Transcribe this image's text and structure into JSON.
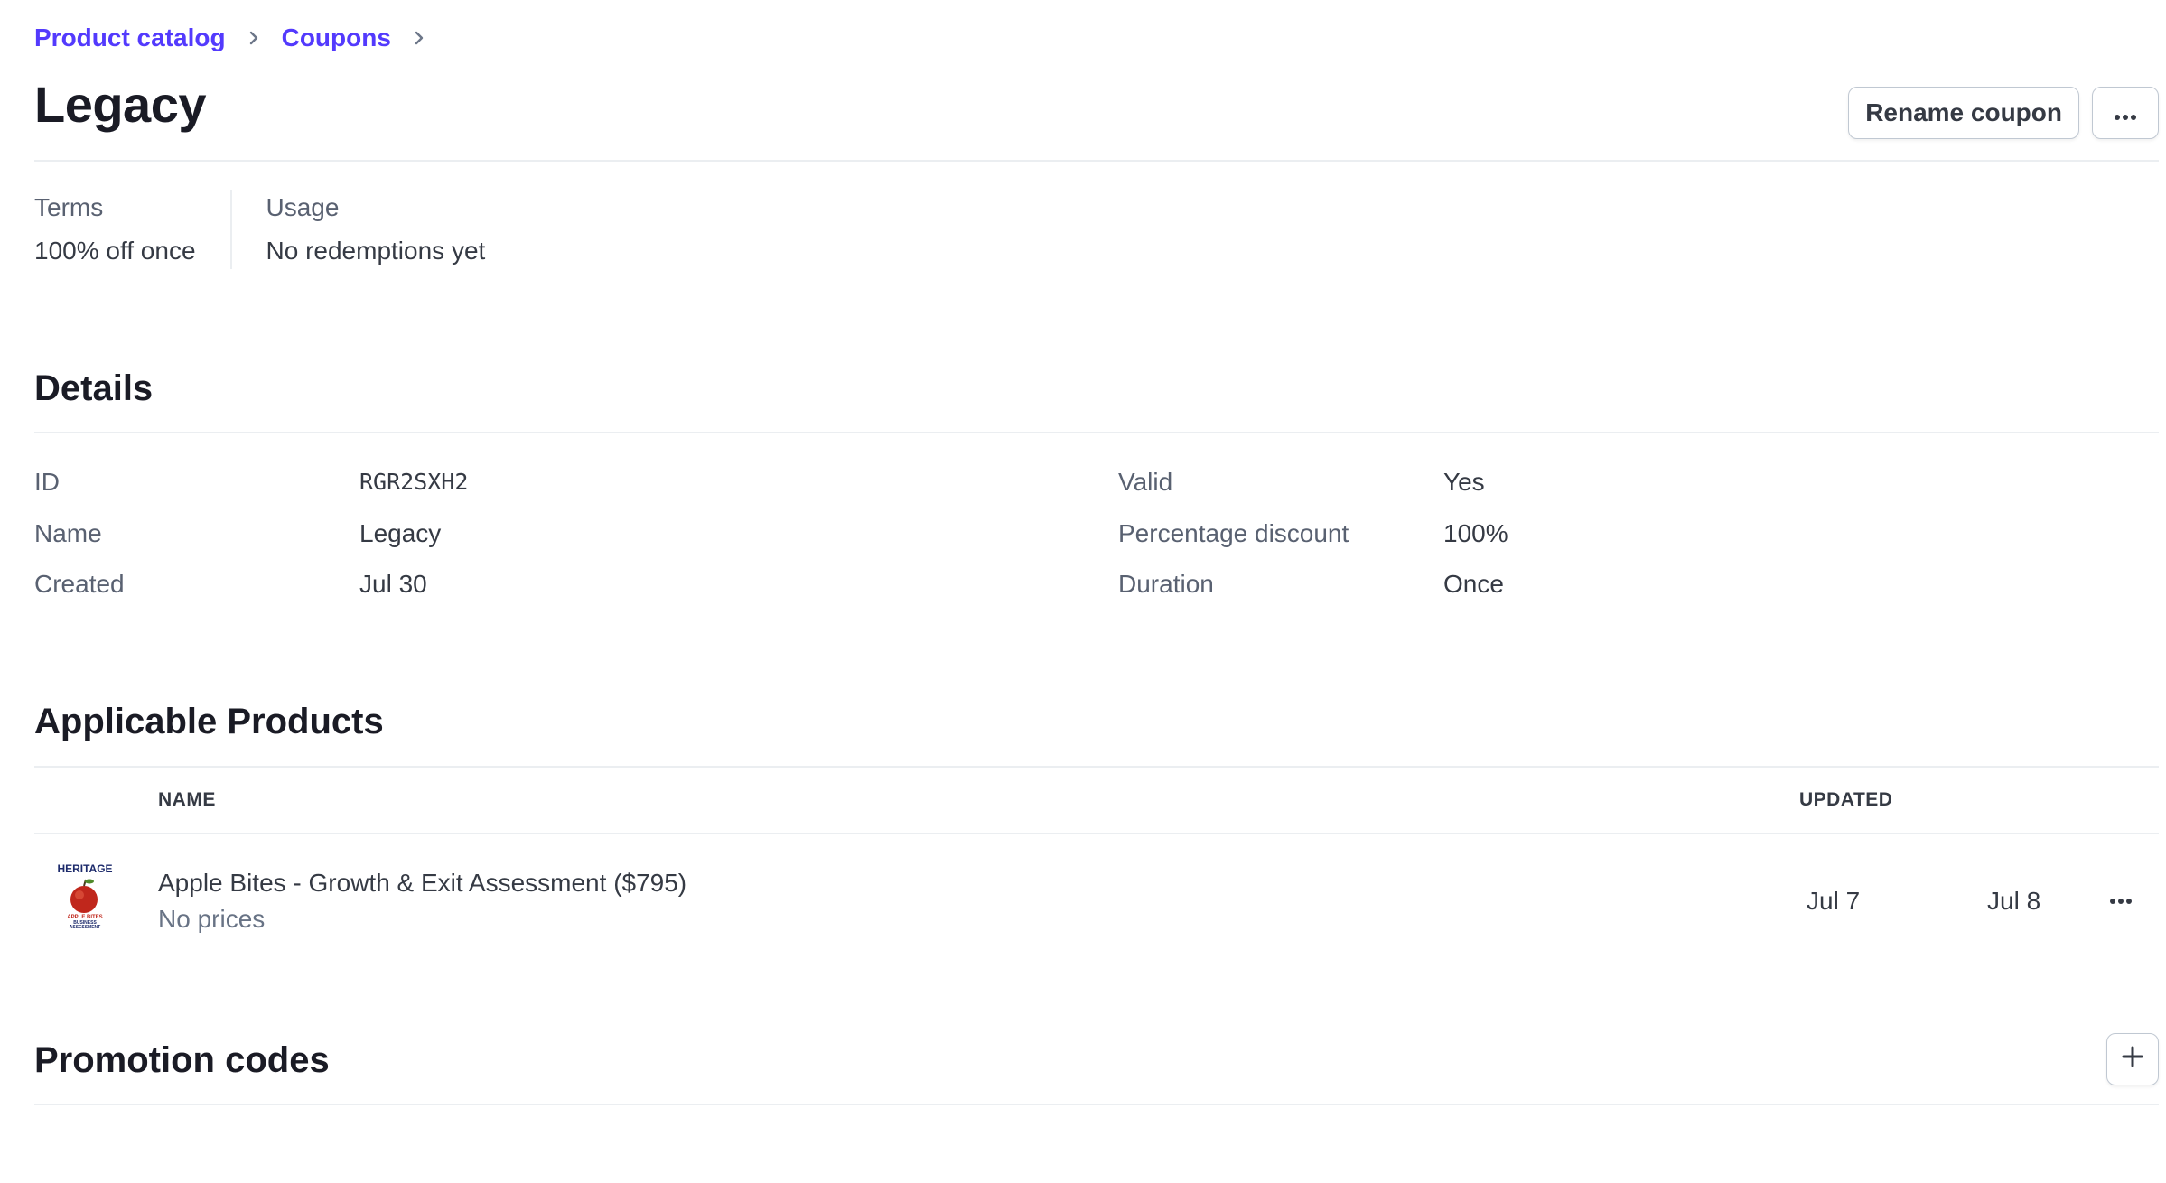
{
  "breadcrumb": {
    "items": [
      "Product catalog",
      "Coupons"
    ]
  },
  "header": {
    "title": "Legacy",
    "rename_label": "Rename coupon",
    "more_icon": "more-icon"
  },
  "summary": {
    "terms_label": "Terms",
    "terms_value": "100% off once",
    "usage_label": "Usage",
    "usage_value": "No redemptions yet"
  },
  "details": {
    "title": "Details",
    "left": [
      {
        "label": "ID",
        "value": "RGR2SXH2"
      },
      {
        "label": "Name",
        "value": "Legacy"
      },
      {
        "label": "Created",
        "value": "Jul 30"
      }
    ],
    "right": [
      {
        "label": "Valid",
        "value": "Yes"
      },
      {
        "label": "Percentage discount",
        "value": "100%"
      },
      {
        "label": "Duration",
        "value": "Once"
      }
    ]
  },
  "products": {
    "title": "Applicable Products",
    "columns": [
      "NAME",
      "UPDATED"
    ],
    "rows": [
      {
        "name": "Apple Bites - Growth & Exit Assessment ($795)",
        "subtitle": "No prices",
        "updated": "Jul 7",
        "second_date": "Jul 8",
        "thumb_text": "HERITAGE"
      }
    ]
  },
  "promotion_codes": {
    "title": "Promotion codes"
  },
  "colors": {
    "accent": "#533afd",
    "border": "#ebeef1",
    "text": "#353a44",
    "muted": "#596171"
  }
}
